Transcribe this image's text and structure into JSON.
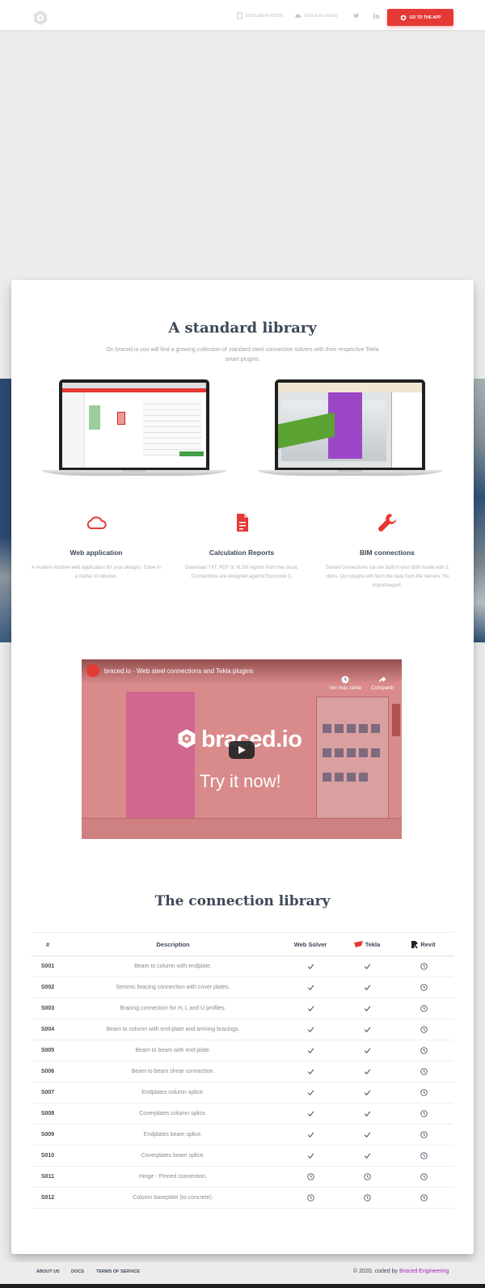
{
  "nav": {
    "documentation": "DOCUMENTATION",
    "tekla_plugins": "TEKLA PLUGINS",
    "app_button": "GO TO THE APP"
  },
  "library": {
    "title": "A standard library",
    "subtitle": "On braced.io you will find a growing collection of standard steel connection solvers with their respective Tekla smart plugins."
  },
  "features": [
    {
      "icon": "cloud-icon",
      "title": "Web application",
      "text": "A modern intuitive web application for your designs. Solve in a matter of minutes."
    },
    {
      "icon": "document-icon",
      "title": "Calculation Reports",
      "text": "Download TXT, PDF or XLSX reports from the cloud. Connections are designed against Eurocode 3."
    },
    {
      "icon": "wrench-icon",
      "title": "BIM connections",
      "text": "Solved connections can be built in your BIM model with 2 clicks. Our plugins will fetch the data from the servers. No import/export."
    }
  ],
  "video": {
    "title": "braced.io - Web steel connections and Tekla plugins",
    "watch_later": "Ver más tarde",
    "share": "Compartir",
    "brand": "braced.io",
    "cta": "Try it now!"
  },
  "connections": {
    "title": "The connection library",
    "headers": {
      "id": "#",
      "description": "Description",
      "web": "Web Solver",
      "tekla": "Tekla",
      "revit": "Revit"
    },
    "rows": [
      {
        "id": "S001",
        "desc": "Beam to column with endplate.",
        "web": "check",
        "tekla": "check",
        "revit": "clock"
      },
      {
        "id": "S002",
        "desc": "Seismic bracing connection with cover plates.",
        "web": "check",
        "tekla": "check",
        "revit": "clock"
      },
      {
        "id": "S003",
        "desc": "Bracing connection for H, L and U profiles.",
        "web": "check",
        "tekla": "check",
        "revit": "clock"
      },
      {
        "id": "S004",
        "desc": "Beam to column with end-plate and arriving bracings.",
        "web": "check",
        "tekla": "check",
        "revit": "clock"
      },
      {
        "id": "S005",
        "desc": "Beam to beam with end-plate.",
        "web": "check",
        "tekla": "check",
        "revit": "clock"
      },
      {
        "id": "S006",
        "desc": "Beam to beam shear connection.",
        "web": "check",
        "tekla": "check",
        "revit": "clock"
      },
      {
        "id": "S007",
        "desc": "Endplates column splice.",
        "web": "check",
        "tekla": "check",
        "revit": "clock"
      },
      {
        "id": "S008",
        "desc": "Coverplates column splice.",
        "web": "check",
        "tekla": "check",
        "revit": "clock"
      },
      {
        "id": "S009",
        "desc": "Endplates beam splice.",
        "web": "check",
        "tekla": "check",
        "revit": "clock"
      },
      {
        "id": "S010",
        "desc": "Coverplates beam splice.",
        "web": "check",
        "tekla": "check",
        "revit": "clock"
      },
      {
        "id": "S011",
        "desc": "Hinge - Pinned connection.",
        "web": "clock",
        "tekla": "clock",
        "revit": "clock"
      },
      {
        "id": "S012",
        "desc": "Column baseplate (to concrete).",
        "web": "clock",
        "tekla": "clock",
        "revit": "clock"
      }
    ]
  },
  "footer": {
    "about": "ABOUT US",
    "docs": "DOCS",
    "terms": "TERMS OF SERVICE",
    "copyright_prefix": "© 2020, coded by",
    "author": "Braced Engineering"
  },
  "colors": {
    "accent": "#e53935",
    "heading": "#3c4858",
    "link": "#9c27b0",
    "band": "#3a5c86"
  }
}
